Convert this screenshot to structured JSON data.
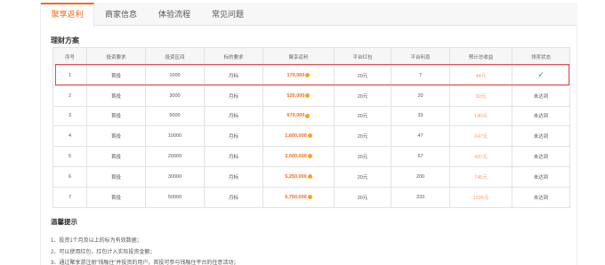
{
  "tabs": [
    {
      "label": "聚享返利",
      "active": true
    },
    {
      "label": "商家信息",
      "active": false
    },
    {
      "label": "体验流程",
      "active": false
    },
    {
      "label": "常见问题",
      "active": false
    }
  ],
  "section_title": "理财方案",
  "table": {
    "headers": [
      "序号",
      "投资要求",
      "投资区间",
      "标的要求",
      "聚享返利",
      "平台红包",
      "平台利息",
      "预计总收益",
      "领奖状态"
    ],
    "rows": [
      {
        "no": "1",
        "req": "首投",
        "range": "1000",
        "target": "月标",
        "rebate": "170,000",
        "red": "20元",
        "interest": "7",
        "total": "44元",
        "status": "✓"
      },
      {
        "no": "2",
        "req": "首投",
        "range": "3000",
        "target": "月标",
        "rebate": "520,000",
        "red": "20元",
        "interest": "20",
        "total": "92元",
        "status": "未达到"
      },
      {
        "no": "3",
        "req": "首投",
        "range": "5000",
        "target": "月标",
        "rebate": "670,000",
        "red": "20元",
        "interest": "33",
        "total": "140元",
        "status": "未达到"
      },
      {
        "no": "4",
        "req": "首投",
        "range": "10000",
        "target": "月标",
        "rebate": "1,600,000",
        "red": "20元",
        "interest": "47",
        "total": "247元",
        "status": "未达到"
      },
      {
        "no": "5",
        "req": "首投",
        "range": "20000",
        "target": "月标",
        "rebate": "3,500,000",
        "red": "20元",
        "interest": "67",
        "total": "437元",
        "status": "未达到"
      },
      {
        "no": "6",
        "req": "首投",
        "range": "30000",
        "target": "月标",
        "rebate": "5,250,000",
        "red": "20元",
        "interest": "200",
        "total": "745元",
        "status": "未达到"
      },
      {
        "no": "7",
        "req": "首投",
        "range": "50000",
        "target": "月标",
        "rebate": "6,750,000",
        "red": "20元",
        "interest": "333",
        "total": "1226元",
        "status": "未达到"
      }
    ]
  },
  "tips": {
    "title": "温馨提示",
    "items": [
      "1、投资1个月及以上的标为有效数据；",
      "2、可以使用红包，红包计入实际投资金额；",
      "3、通过聚享游注册“钱融住”并投资的用户，首投可参与钱融住平台的任意活动；"
    ]
  }
}
